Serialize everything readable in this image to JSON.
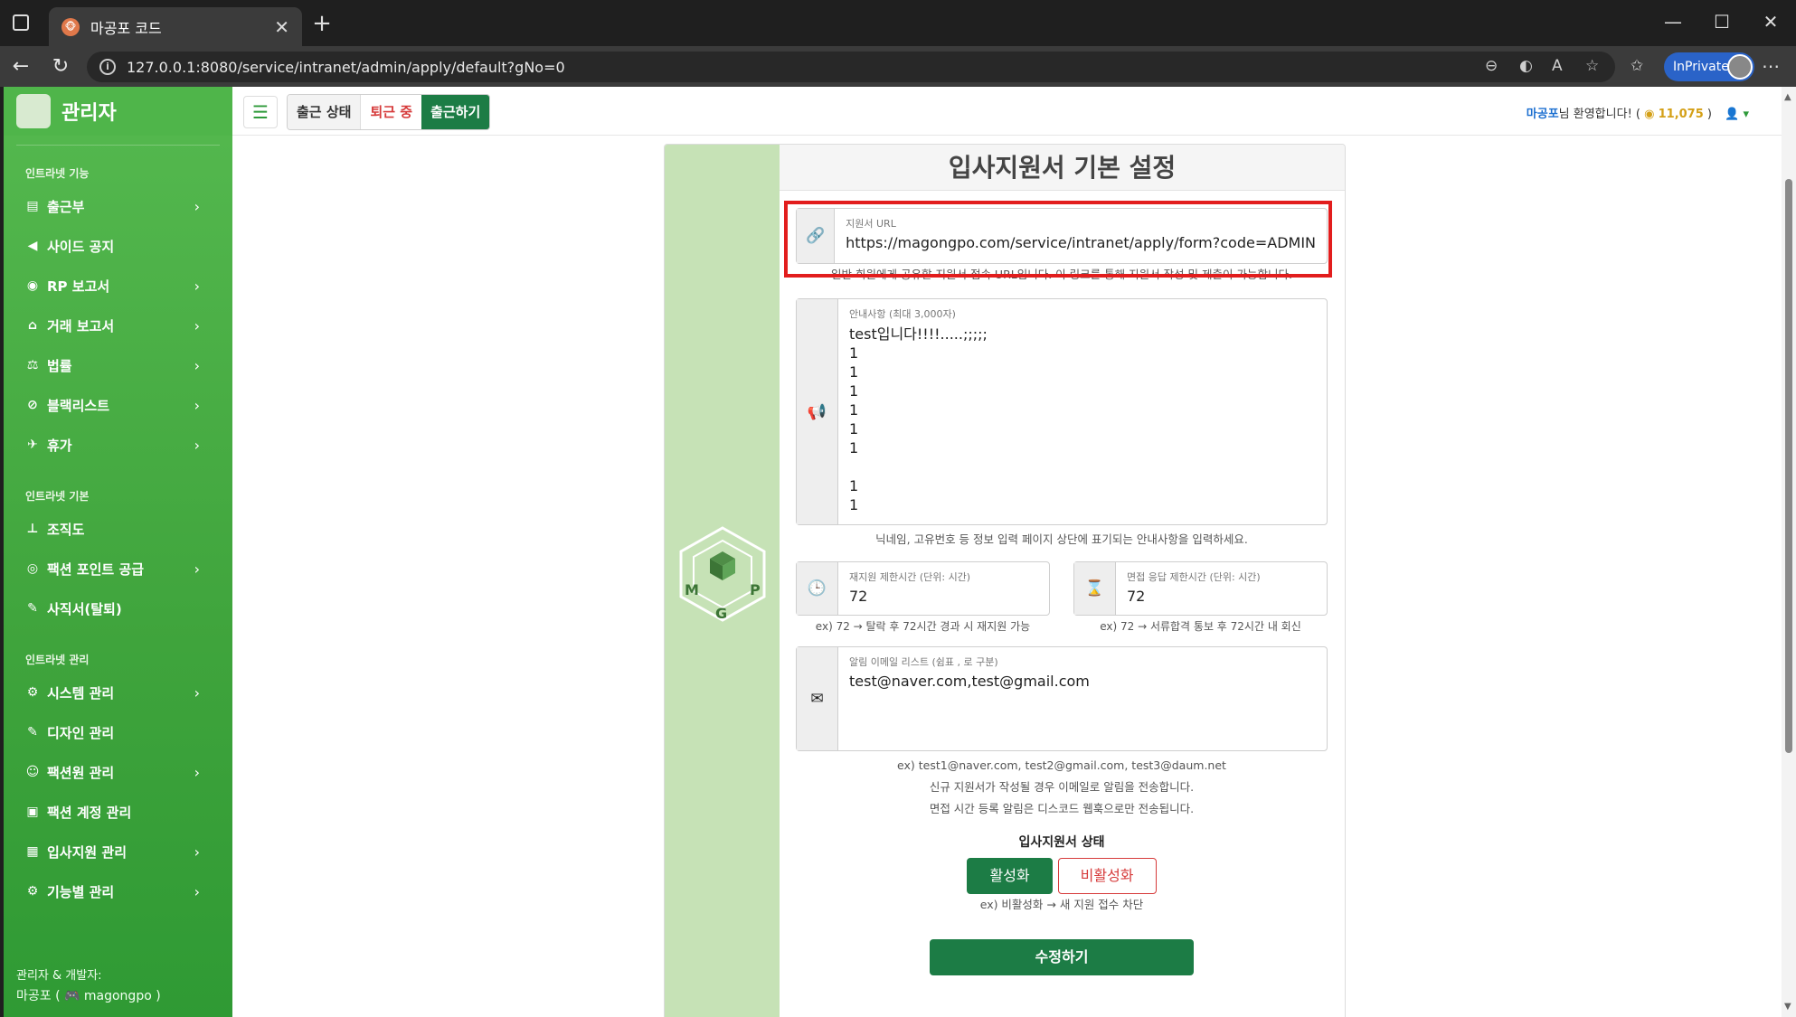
{
  "browser": {
    "tab_title": "마공포 코드",
    "url": "127.0.0.1:8080/service/intranet/admin/apply/default?gNo=0",
    "inprivate_label": "InPrivate"
  },
  "sidebar": {
    "brand": "관리자",
    "sections": [
      {
        "heading": "인트라넷 기능",
        "items": [
          {
            "label": "출근부",
            "icon": "book-icon",
            "glyph": "▤",
            "chevron": true
          },
          {
            "label": "사이드 공지",
            "icon": "megaphone-icon",
            "glyph": "◀",
            "chevron": false
          },
          {
            "label": "RP 보고서",
            "icon": "gamepad-icon",
            "glyph": "◉",
            "chevron": true
          },
          {
            "label": "거래 보고서",
            "icon": "building-icon",
            "glyph": "⌂",
            "chevron": true
          },
          {
            "label": "법률",
            "icon": "scale-icon",
            "glyph": "⚖",
            "chevron": true
          },
          {
            "label": "블랙리스트",
            "icon": "ban-icon",
            "glyph": "⊘",
            "chevron": true
          },
          {
            "label": "휴가",
            "icon": "plane-icon",
            "glyph": "✈",
            "chevron": true
          }
        ]
      },
      {
        "heading": "인트라넷 기본",
        "items": [
          {
            "label": "조직도",
            "icon": "sitemap-icon",
            "glyph": "⊥",
            "chevron": false
          },
          {
            "label": "팩션 포인트 공급",
            "icon": "coins-icon",
            "glyph": "◎",
            "chevron": true
          },
          {
            "label": "사직서(탈퇴)",
            "icon": "pen-icon",
            "glyph": "✎",
            "chevron": false
          }
        ]
      },
      {
        "heading": "인트라넷 관리",
        "items": [
          {
            "label": "시스템 관리",
            "icon": "gear-icon",
            "glyph": "⚙",
            "chevron": true
          },
          {
            "label": "디자인 관리",
            "icon": "brush-icon",
            "glyph": "✎",
            "chevron": false
          },
          {
            "label": "팩션원 관리",
            "icon": "users-gear-icon",
            "glyph": "☺",
            "chevron": true
          },
          {
            "label": "팩션 계정 관리",
            "icon": "id-card-icon",
            "glyph": "▣",
            "chevron": false
          },
          {
            "label": "입사지원 관리",
            "icon": "inbox-icon",
            "glyph": "▦",
            "chevron": true
          },
          {
            "label": "기능별 관리",
            "icon": "gears-icon",
            "glyph": "⚙",
            "chevron": true
          }
        ]
      }
    ],
    "footer_line1": "관리자 & 개발자:",
    "footer_line2": "마공포 ( 🎮 magongpo )"
  },
  "topbar": {
    "attendance_status_label": "출근 상태",
    "attendance_state": "퇴근 중",
    "clock_in_button": "출근하기",
    "welcome_user": "마공포",
    "welcome_text": "님 환영합니다! (",
    "points": "11,075",
    "welcome_close": " )"
  },
  "form": {
    "title": "입사지원서 기본 설정",
    "url_label": "지원서 URL",
    "url_value": "https://magongpo.com/service/intranet/apply/form?code=ADMIN",
    "url_help": "일반 회원에게 공유할 지원서 접속 URL입니다. 이 링크를 통해 지원서 작성 및 제출이 가능합니다.",
    "notice_label": "안내사항 (최대 3,000자)",
    "notice_value": "test입니다!!!!.....;;;;;\n1\n1\n1\n1\n1\n1\n\n1\n1",
    "notice_help": "닉네임, 고유번호 등 정보 입력 페이지 상단에 표기되는 안내사항을 입력하세요.",
    "reapply_label": "재지원 제한시간 (단위: 시간)",
    "reapply_value": "72",
    "reapply_help": "ex) 72 → 탈락 후 72시간 경과 시 재지원 가능",
    "interview_label": "면접 응답 제한시간 (단위: 시간)",
    "interview_value": "72",
    "interview_help": "ex) 72 → 서류합격 통보 후 72시간 내 회신",
    "email_label": "알림 이메일 리스트 (쉼표 , 로 구분)",
    "email_value": "test@naver.com,test@gmail.com",
    "email_help1": "ex) test1@naver.com, test2@gmail.com, test3@daum.net",
    "email_help2": "신규 지원서가 작성될 경우 이메일로 알림을 전송합니다.",
    "email_help3": "면접 시간 등록 알림은 디스코드 웹훅으로만 전송됩니다.",
    "status_label": "입사지원서 상태",
    "activate_label": "활성화",
    "deactivate_label": "비활성화",
    "status_help": "ex) 비활성화 → 새 지원 접수 차단",
    "submit_label": "수정하기"
  }
}
